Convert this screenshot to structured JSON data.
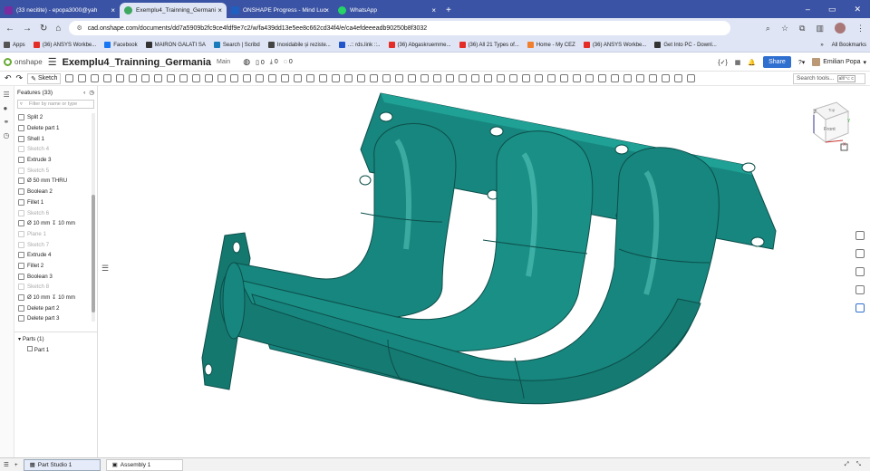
{
  "browser": {
    "tabs": [
      {
        "label": "(33 necitite) - epopa3000@yah",
        "color": "#7a2ba0"
      },
      {
        "label": "Exemplu4_Trainning_Germani",
        "color": "#3fa860"
      },
      {
        "label": "ONSHAPE Progress - Mind Luc",
        "color": "#1f5fbf"
      },
      {
        "label": "WhatsApp",
        "color": "#25d366"
      }
    ],
    "new_tab": "+",
    "url": "cad.onshape.com/documents/dd7a5909b2fc9ce4fdf9e7c2/w/fa439dd13e5ee8c662cd34f4/e/ca4efdeeeadb90250b8f3032",
    "bookmarks": [
      {
        "label": "Apps",
        "color": "#555555"
      },
      {
        "label": "(36) ANSYS Workbe...",
        "color": "#e52d27"
      },
      {
        "label": "Facebook",
        "color": "#1877f2"
      },
      {
        "label": "MAIRON GALATI SA",
        "color": "#333333"
      },
      {
        "label": "Search | Scribd",
        "color": "#1a7bba"
      },
      {
        "label": "Inoxidabile și reziste...",
        "color": "#444444"
      },
      {
        "label": "..:: rds.link ::..",
        "color": "#2255cc"
      },
      {
        "label": "(36) Abgaskruemme...",
        "color": "#e52d27"
      },
      {
        "label": "(36) All 21 Types of...",
        "color": "#e52d27"
      },
      {
        "label": "Home - My CEZ",
        "color": "#f08030"
      },
      {
        "label": "(36) ANSYS Workbe...",
        "color": "#e52d27"
      },
      {
        "label": "Get Into PC - Downl...",
        "color": "#333333"
      }
    ],
    "more": "»",
    "all_bookmarks": "All Bookmarks"
  },
  "onshape": {
    "logo": "onshape",
    "doc_title": "Exemplu4_Trainning_Germania",
    "branch": "Main",
    "counts": [
      "0",
      "0",
      "0"
    ],
    "share": "Share",
    "user": "Emilian Popa",
    "sketch": "Sketch",
    "search_tools": "Search tools...",
    "search_shortcut": "alt/⌥ c"
  },
  "features": {
    "header": "Features (33)",
    "filter_placeholder": "Filter by name or type",
    "items": [
      {
        "label": "Split 2",
        "muted": false
      },
      {
        "label": "Delete part 1",
        "muted": false
      },
      {
        "label": "Shell 1",
        "muted": false
      },
      {
        "label": "Sketch 4",
        "muted": true
      },
      {
        "label": "Extrude 3",
        "muted": false
      },
      {
        "label": "Sketch 5",
        "muted": true
      },
      {
        "label": "Ø 50 mm THRU",
        "muted": false
      },
      {
        "label": "Boolean 2",
        "muted": false
      },
      {
        "label": "Fillet 1",
        "muted": false
      },
      {
        "label": "Sketch 6",
        "muted": true
      },
      {
        "label": "Ø 10 mm ↧ 10 mm",
        "muted": false
      },
      {
        "label": "Plane 1",
        "muted": true
      },
      {
        "label": "Sketch 7",
        "muted": true
      },
      {
        "label": "Extrude 4",
        "muted": false
      },
      {
        "label": "Fillet 2",
        "muted": false
      },
      {
        "label": "Boolean 3",
        "muted": false
      },
      {
        "label": "Sketch 8",
        "muted": true
      },
      {
        "label": "Ø 10 mm ↧ 10 mm",
        "muted": false
      },
      {
        "label": "Delete part 2",
        "muted": false
      },
      {
        "label": "Delete part 3",
        "muted": false
      }
    ],
    "parts_header": "Parts (1)",
    "part": "Part 1"
  },
  "viewcube": {
    "top": "Top",
    "front": "Front",
    "z": "Z",
    "x": "X",
    "y": "Y"
  },
  "model": {
    "color": "#17867e",
    "shade": "#0f5f59"
  },
  "bottom": {
    "tabs": [
      "Part Studio 1",
      "Assembly 1"
    ]
  }
}
